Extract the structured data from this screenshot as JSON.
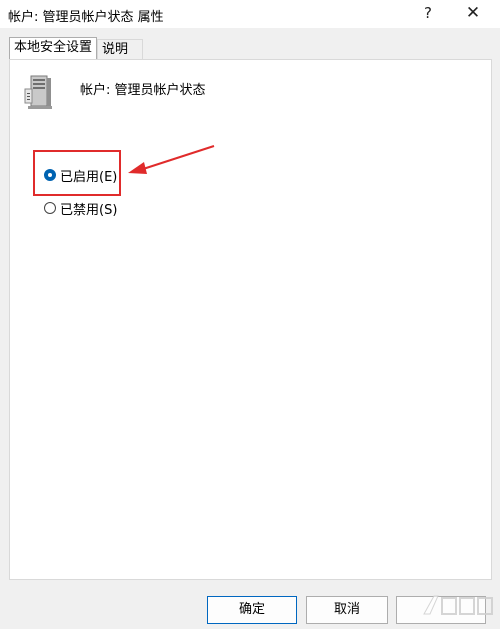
{
  "window": {
    "title": "帐户: 管理员帐户状态 属性",
    "help_symbol": "?",
    "close_symbol": "✕"
  },
  "tabs": [
    {
      "label": "本地安全设置",
      "active": true
    },
    {
      "label": "说明",
      "active": false
    }
  ],
  "setting": {
    "icon": "server-icon",
    "label": "帐户: 管理员帐户状态"
  },
  "options": [
    {
      "label": "已启用(E)",
      "checked": true
    },
    {
      "label": "已禁用(S)",
      "checked": false
    }
  ],
  "buttons": {
    "ok": "确定",
    "cancel": "取消"
  },
  "annotation": {
    "color": "#e02b2b"
  },
  "colors": {
    "accent": "#0063b1"
  }
}
